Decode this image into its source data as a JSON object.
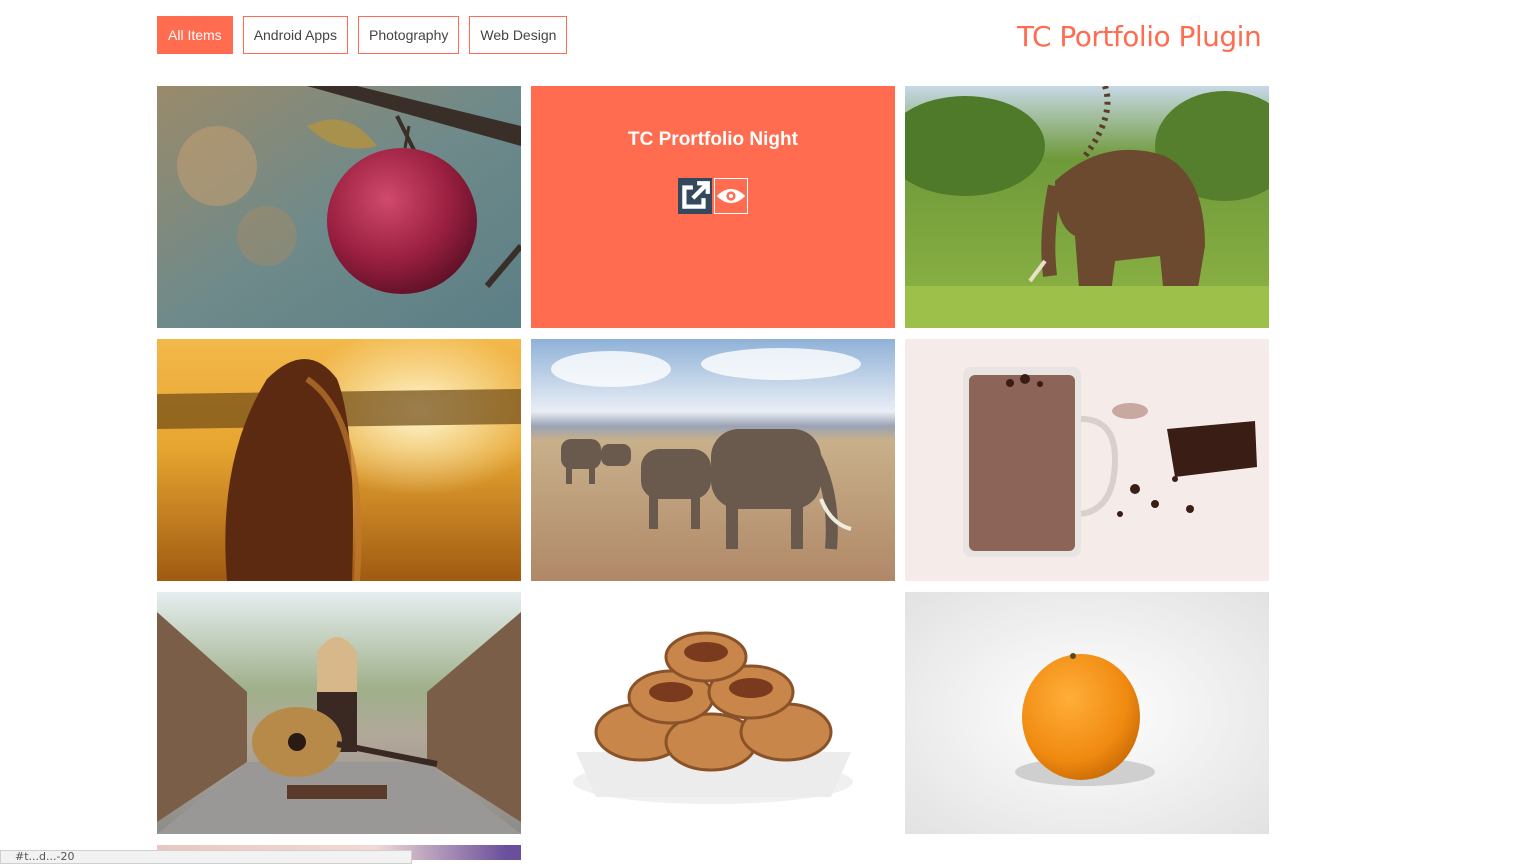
{
  "filters": [
    {
      "label": "All Items",
      "active": true
    },
    {
      "label": "Android Apps",
      "active": false
    },
    {
      "label": "Photography",
      "active": false
    },
    {
      "label": "Web Design",
      "active": false
    }
  ],
  "site_title": "TC Portfolio Plugin",
  "hover_item": {
    "title": "TC Prortfolio Night",
    "actions": [
      "external-link-icon",
      "eye-icon"
    ]
  },
  "tiles": [
    {
      "subject": "apple"
    },
    {
      "subject": "hovered"
    },
    {
      "subject": "elephant"
    },
    {
      "subject": "girl-sunset"
    },
    {
      "subject": "elephant-herd"
    },
    {
      "subject": "hot-chocolate"
    },
    {
      "subject": "girl-guitar"
    },
    {
      "subject": "pecans"
    },
    {
      "subject": "orange"
    }
  ],
  "status_url": "#t...d...-20",
  "colors": {
    "accent": "#ff6c4f",
    "link_button": "#34495e"
  }
}
